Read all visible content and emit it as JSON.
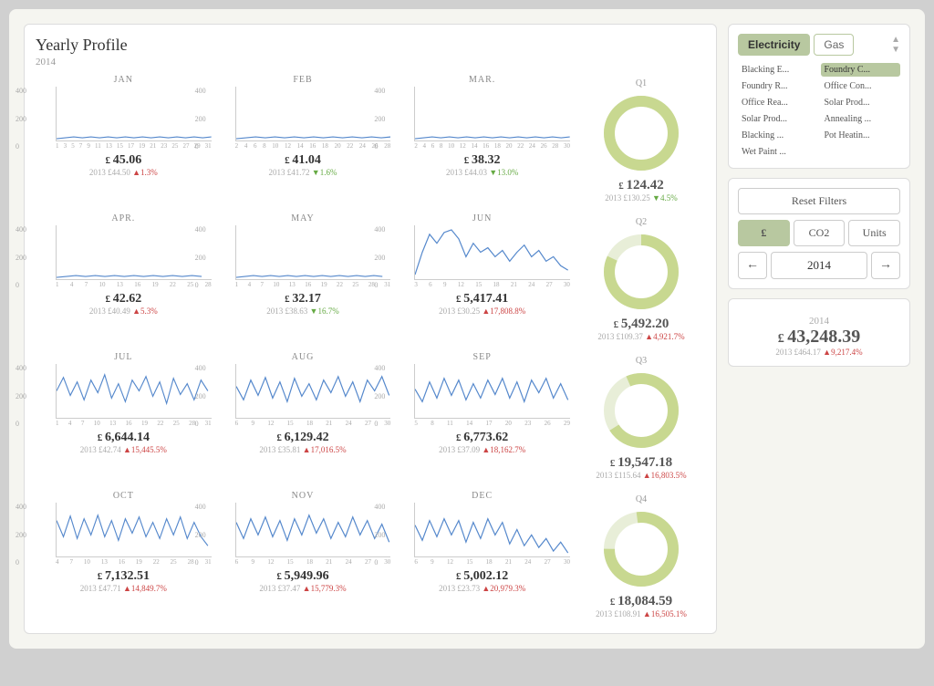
{
  "title": "Yearly Profile",
  "year": "2014",
  "tabs": {
    "electricity": "Electricity",
    "gas": "Gas"
  },
  "filters": [
    {
      "label": "Blacking E...",
      "active": false
    },
    {
      "label": "Foundry C...",
      "active": true
    },
    {
      "label": "Foundry R...",
      "active": false
    },
    {
      "label": "Office Con...",
      "active": false
    },
    {
      "label": "Office Rea...",
      "active": false
    },
    {
      "label": "Solar Prod...",
      "active": false
    },
    {
      "label": "Solar Prod...",
      "active": false
    },
    {
      "label": "Annealing ...",
      "active": false
    },
    {
      "label": "Blacking ...",
      "active": false
    },
    {
      "label": "Pot Heatin...",
      "active": false
    },
    {
      "label": "Wet Paint ...",
      "active": false
    }
  ],
  "reset_label": "Reset Filters",
  "units": {
    "pound": "£",
    "co2": "CO2",
    "units": "Units"
  },
  "nav": {
    "prev": "←",
    "next": "→",
    "year": "2014"
  },
  "months": [
    {
      "label": "JAN",
      "value": "45.06",
      "prev_year": "£44.50",
      "change": "▲1.3%",
      "direction": "up",
      "x_labels": "1 3 5 7 9 11 13 15 17 19 21 23 25 27 29 31"
    },
    {
      "label": "FEB",
      "value": "41.04",
      "prev_year": "£41.72",
      "change": "▼1.6%",
      "direction": "down",
      "x_labels": "2 4 6 8 10 12 14 16 18 20 22 24 26 28"
    },
    {
      "label": "MAR.",
      "value": "38.32",
      "prev_year": "£44.03",
      "change": "▼13.0%",
      "direction": "down",
      "x_labels": "2 4 6 8 10 12 14 16 18 20 22 24 26 28 30"
    },
    {
      "label": "APR.",
      "value": "42.62",
      "prev_year": "£40.49",
      "change": "▲5.3%",
      "direction": "up",
      "x_labels": "1 4 7 10 13 16 19 22 25 28"
    },
    {
      "label": "MAY",
      "value": "32.17",
      "prev_year": "£38.63",
      "change": "▼16.7%",
      "direction": "down",
      "x_labels": "1 4 7 10 13 16 19 22 25 28 31"
    },
    {
      "label": "JUN",
      "value": "5,417.41",
      "prev_year": "£30.25",
      "change": "▲17,808.8%",
      "direction": "up",
      "x_labels": "3 6 9 12 15 18 21 24 27 30"
    },
    {
      "label": "JUL",
      "value": "6,644.14",
      "prev_year": "£42.74",
      "change": "▲15,445.5%",
      "direction": "up",
      "x_labels": "1 4 7 10 13 16 19 22 25 28 31"
    },
    {
      "label": "AUG",
      "value": "6,129.42",
      "prev_year": "£35.81",
      "change": "▲17,016.5%",
      "direction": "up",
      "x_labels": "6 9 12 15 18 21 24 27 30"
    },
    {
      "label": "SEP",
      "value": "6,773.62",
      "prev_year": "£37.09",
      "change": "▲18,162.7%",
      "direction": "up",
      "x_labels": "5 8 11 14 17 20 23 26 29"
    },
    {
      "label": "OCT",
      "value": "7,132.51",
      "prev_year": "£47.71",
      "change": "▲14,849.7%",
      "direction": "up",
      "x_labels": "4 7 10 13 16 19 22 25 28 31"
    },
    {
      "label": "NOV",
      "value": "5,949.96",
      "prev_year": "£37.47",
      "change": "▲15,779.3%",
      "direction": "up",
      "x_labels": "6 9 12 15 18 21 24 27 30"
    },
    {
      "label": "DEC",
      "value": "5,002.12",
      "prev_year": "£23.73",
      "change": "▲20,979.3%",
      "direction": "up",
      "x_labels": "6 9 12 15 18 21 24 27 30"
    }
  ],
  "quarters": [
    {
      "label": "Q1",
      "value": "124.42",
      "prev_year": "2013  £130.25",
      "change": "▼4.5%",
      "direction": "down"
    },
    {
      "label": "Q2",
      "value": "5,492.20",
      "prev_year": "2013  £109.37",
      "change": "▲4,921.7%",
      "direction": "up"
    },
    {
      "label": "Q3",
      "value": "19,547.18",
      "prev_year": "2013  £115.64",
      "change": "▲16,803.5%",
      "direction": "up"
    },
    {
      "label": "Q4",
      "value": "18,084.59",
      "prev_year": "2013  £108.91",
      "change": "▲16,505.1%",
      "direction": "up"
    }
  ],
  "total": {
    "year": "2014",
    "value": "43,248.39",
    "prev_year": "2013  £464.17",
    "change": "▲9,217.4%",
    "direction": "up"
  }
}
